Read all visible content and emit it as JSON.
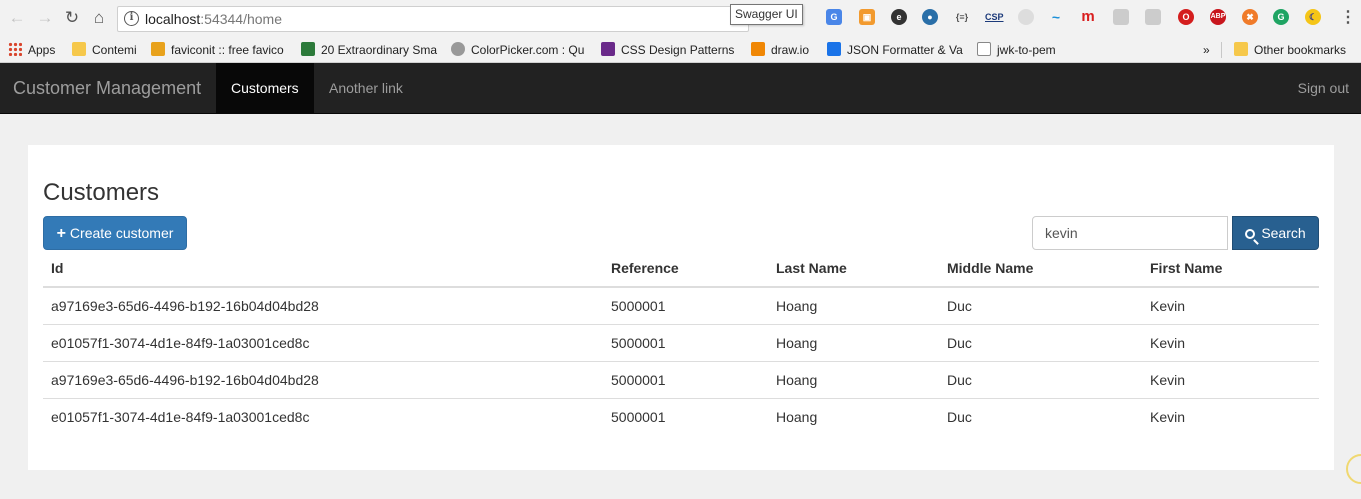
{
  "browser": {
    "url_host": "localhost",
    "url_rest": ":54344/home",
    "tooltip": "Swagger UI",
    "bookmarks": [
      {
        "label": "Apps"
      },
      {
        "label": "Contemi"
      },
      {
        "label": "faviconit :: free favico"
      },
      {
        "label": "20 Extraordinary Sma"
      },
      {
        "label": "ColorPicker.com : Qu"
      },
      {
        "label": "CSS Design Patterns"
      },
      {
        "label": "draw.io"
      },
      {
        "label": "JSON Formatter & Va"
      },
      {
        "label": "jwk-to-pem"
      },
      {
        "label": "»"
      },
      {
        "label": "Other bookmarks"
      }
    ]
  },
  "navbar": {
    "brand": "Customer Management",
    "links": [
      {
        "label": "Customers",
        "active": true
      },
      {
        "label": "Another link",
        "active": false
      }
    ],
    "signout": "Sign out"
  },
  "page": {
    "title": "Customers",
    "create_label": "Create customer",
    "search_value": "kevin",
    "search_label": "Search"
  },
  "table": {
    "headers": [
      "Id",
      "Reference",
      "Last Name",
      "Middle Name",
      "First Name"
    ],
    "rows": [
      [
        "a97169e3-65d6-4496-b192-16b04d04bd28",
        "5000001",
        "Hoang",
        "Duc",
        "Kevin"
      ],
      [
        "e01057f1-3074-4d1e-84f9-1a03001ced8c",
        "5000001",
        "Hoang",
        "Duc",
        "Kevin"
      ],
      [
        "a97169e3-65d6-4496-b192-16b04d04bd28",
        "5000001",
        "Hoang",
        "Duc",
        "Kevin"
      ],
      [
        "e01057f1-3074-4d1e-84f9-1a03001ced8c",
        "5000001",
        "Hoang",
        "Duc",
        "Kevin"
      ]
    ]
  }
}
